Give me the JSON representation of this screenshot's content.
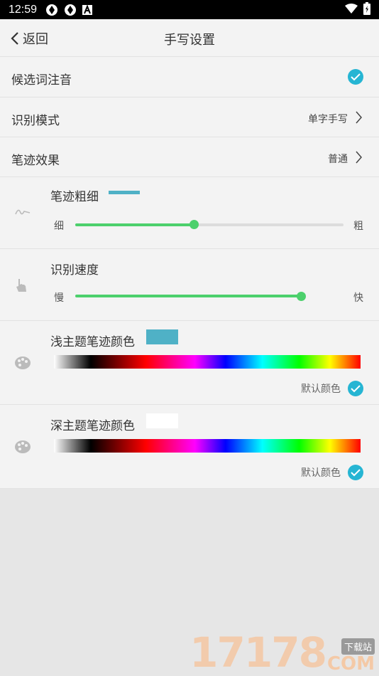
{
  "status_bar": {
    "time": "12:59"
  },
  "header": {
    "back_label": "返回",
    "title": "手写设置"
  },
  "rows": {
    "pinyin": {
      "label": "候选词注音",
      "checked": true
    },
    "recog_mode": {
      "label": "识别模式",
      "value": "单字手写"
    },
    "stroke_effect": {
      "label": "笔迹效果",
      "value": "普通"
    }
  },
  "stroke_width": {
    "label": "笔迹粗细",
    "min_label": "细",
    "max_label": "粗",
    "level": 0.5,
    "preview_color": "#4fb1c6"
  },
  "recog_speed": {
    "label": "识别速度",
    "min_label": "慢",
    "max_label": "快",
    "level": 0.92
  },
  "light_theme": {
    "label": "浅主题笔迹颜色",
    "swatch_color": "#4fb1c6",
    "default_label": "默认颜色",
    "default_checked": true
  },
  "dark_theme": {
    "label": "深主题笔迹颜色",
    "swatch_color": "#ffffff",
    "default_label": "默认颜色",
    "default_checked": true
  },
  "colors": {
    "accent": "#26b5d3",
    "slider": "#4cd06c",
    "annotation_arrow": "#e02020"
  },
  "watermark": {
    "number": "17178",
    "tag": "下载站",
    "domain": "COM"
  }
}
